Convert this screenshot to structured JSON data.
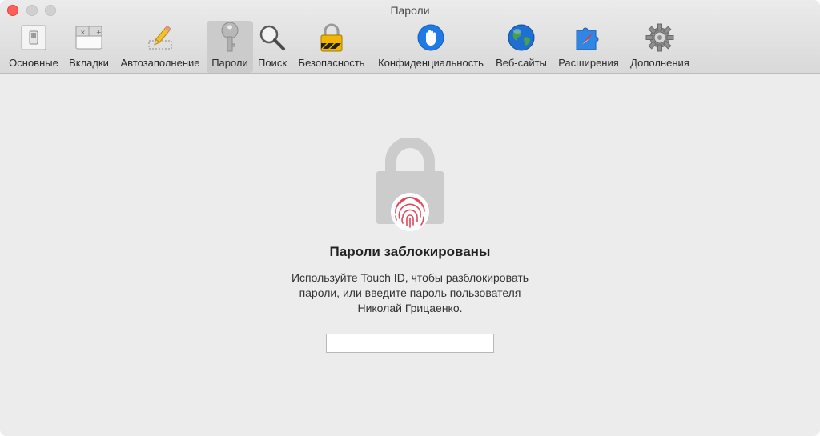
{
  "window": {
    "title": "Пароли"
  },
  "toolbar": {
    "tabs": [
      {
        "label": "Основные",
        "icon": "general-switch-icon"
      },
      {
        "label": "Вкладки",
        "icon": "tabs-window-icon"
      },
      {
        "label": "Автозаполнение",
        "icon": "pencil-icon"
      },
      {
        "label": "Пароли",
        "icon": "key-icon",
        "active": true
      },
      {
        "label": "Поиск",
        "icon": "magnifier-icon"
      },
      {
        "label": "Безопасность",
        "icon": "padlock-icon"
      },
      {
        "label": "Конфиденциальность",
        "icon": "hand-icon"
      },
      {
        "label": "Веб-сайты",
        "icon": "globe-icon"
      },
      {
        "label": "Расширения",
        "icon": "puzzle-compass-icon"
      },
      {
        "label": "Дополнения",
        "icon": "gear-icon"
      }
    ]
  },
  "locked": {
    "heading": "Пароли заблокированы",
    "line1": "Используйте Touch ID, чтобы разблокировать",
    "line2": "пароли, или введите пароль пользователя",
    "line3": "Николай Грицаенко.",
    "password_value": ""
  },
  "colors": {
    "close": "#fe5f57",
    "accent_blue": "#1f7ae6",
    "fingerprint": "#e0475a"
  }
}
